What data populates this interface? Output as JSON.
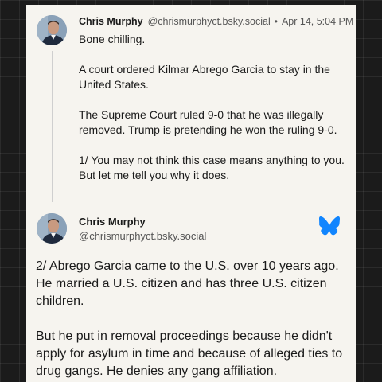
{
  "post1": {
    "author_name": "Chris Murphy",
    "author_handle": "@chrismurphyct.bsky.social",
    "separator": "•",
    "timestamp": "Apr 14, 5:04 PM",
    "paragraphs": [
      "Bone chilling.",
      "A court ordered Kilmar Abrego Garcia to stay in the United States.",
      "The Supreme Court ruled 9-0 that he was illegally removed. Trump is pretending he won the ruling 9-0.",
      "1/ You may not think this case means anything to you. But let me tell you why it does."
    ]
  },
  "post2": {
    "author_name": "Chris Murphy",
    "author_handle": "@chrismurphyct.bsky.social",
    "paragraphs": [
      "2/ Abrego Garcia came to the U.S. over 10 years ago. He married a U.S. citizen and has three U.S. citizen children.",
      "But he put in removal proceedings because he didn't apply for asylum in time and because of alleged ties to drug gangs. He denies any gang affiliation."
    ]
  },
  "icons": {
    "avatar": "avatar",
    "platform": "butterfly-icon"
  },
  "colors": {
    "card_background": "#f6f4ef",
    "page_background": "#1b1b1b",
    "bluesky_blue": "#1185fe"
  }
}
